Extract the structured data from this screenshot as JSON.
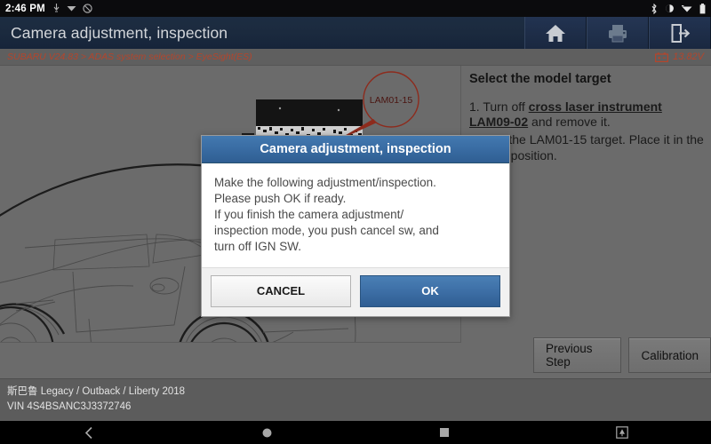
{
  "status_bar": {
    "time": "2:46 PM",
    "left_icons": [
      "usb-debug-icon",
      "vpn-icon",
      "do-not-disturb-icon"
    ],
    "right_icons": [
      "bluetooth-icon",
      "alarm-icon",
      "wifi-icon",
      "battery-icon"
    ]
  },
  "title_bar": {
    "title": "Camera adjustment, inspection",
    "buttons": [
      {
        "name": "home-button",
        "icon": "home-icon"
      },
      {
        "name": "print-button",
        "icon": "printer-icon"
      },
      {
        "name": "exit-button",
        "icon": "exit-icon"
      }
    ]
  },
  "breadcrumb": {
    "path": "SUBARU V24.83 > ADAS system selection > EyeSight(ES)",
    "battery_icon": "battery-voltage-icon",
    "voltage": "13.82V"
  },
  "illustration": {
    "callout_label": "LAM01-15",
    "alt": "side view line drawing of vehicle with calibration target board"
  },
  "info_panel": {
    "heading": "Select the model target",
    "steps": [
      {
        "prefix": "1. Turn off ",
        "emphasis": "cross laser instrument LAM09-02",
        "suffix": " and remove it."
      },
      {
        "prefix": "2. Use the LAM01-15 target. Place it in ",
        "emphasis": "",
        "suffix": "the correct position."
      }
    ]
  },
  "actions": {
    "previous_step": "Previous Step",
    "calibration": "Calibration"
  },
  "footer": {
    "vehicle": "斯巴鲁 Legacy / Outback / Liberty 2018",
    "vin": "VIN 4S4BSANC3J3372746"
  },
  "nav_bar": {
    "items": [
      "back-icon",
      "home-circle-icon",
      "recents-square-icon",
      "screenshot-icon"
    ]
  },
  "dialog": {
    "title": "Camera adjustment, inspection",
    "line1": "Make the following adjustment/inspection.",
    "line2": "Please push OK if ready.",
    "line3": "If you finish the camera adjustment/",
    "line4": "inspection mode, you push cancel sw, and",
    "line5": "turn off IGN SW.",
    "cancel_label": "CANCEL",
    "ok_label": "OK"
  },
  "colors": {
    "titlebar": "#1b2a3e",
    "accent_blue": "#3a6da4",
    "breadcrumb_text": "#b4452c",
    "page_bg": "#6b6b6b"
  }
}
